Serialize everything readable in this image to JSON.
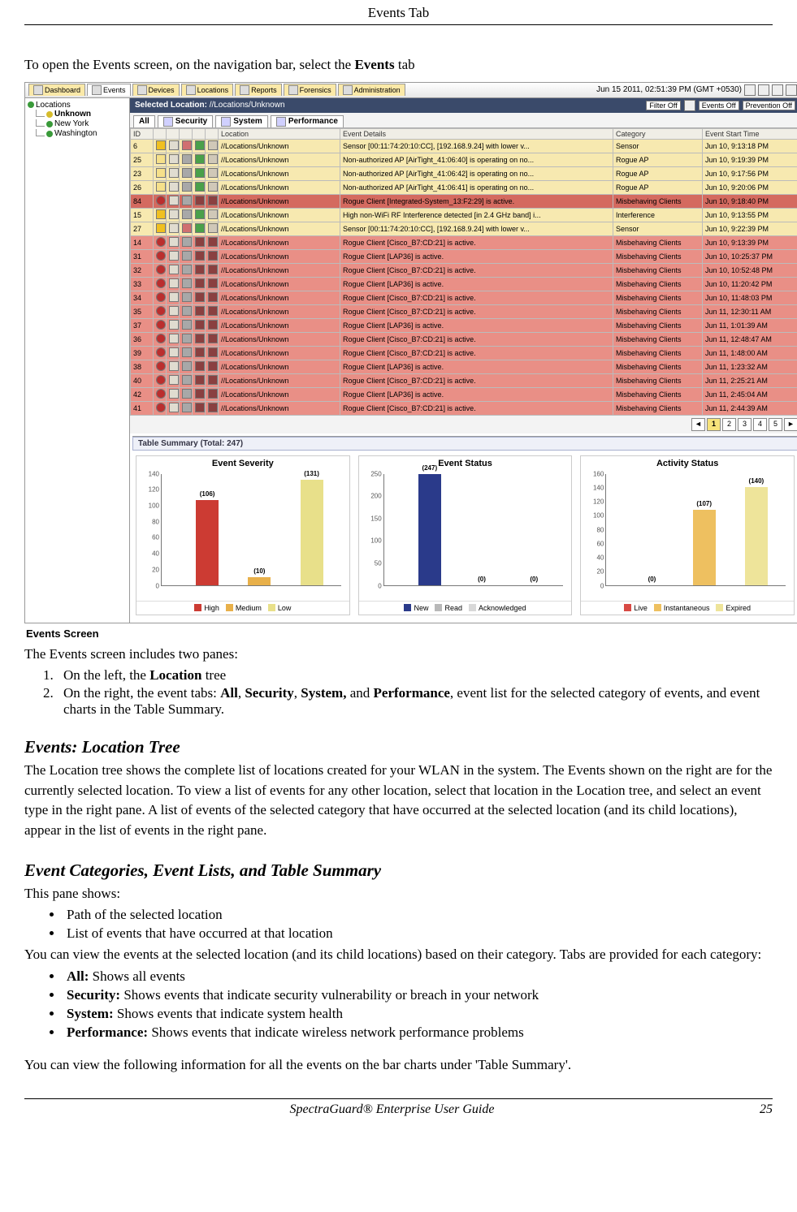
{
  "page": {
    "header_title": "Events Tab",
    "footer_left": "SpectraGuard® Enterprise User Guide",
    "footer_page": "25"
  },
  "intro": {
    "pre": "To open the Events screen, on the navigation bar, select the ",
    "bold": "Events",
    "post": " tab"
  },
  "fig": {
    "caption": "Events Screen",
    "nav_tabs": [
      "Dashboard",
      "Events",
      "Devices",
      "Locations",
      "Reports",
      "Forensics",
      "Administration"
    ],
    "clock": "Jun 15 2011, 02:51:39 PM (GMT +0530)",
    "selected_location_label": "Selected Location:",
    "selected_location_path": "//Locations/Unknown",
    "filter_label": "Filter Off",
    "events_off": "Events Off",
    "prevention_off": "Prevention Off",
    "loc_tree": [
      "Locations",
      "Unknown",
      "New York",
      "Washington"
    ],
    "subtabs": [
      "All",
      "Security",
      "System",
      "Performance"
    ],
    "columns": [
      "ID",
      "",
      "",
      "",
      "",
      "",
      "Location",
      "Event Details",
      "Category",
      "Event Start Time"
    ],
    "rows": [
      {
        "cls": "r-yellow",
        "id": "6",
        "i": [
          "warn",
          "mail",
          "del",
          "ok",
          "lock"
        ],
        "loc": "//Locations/Unknown",
        "det": "Sensor [00:11:74:20:10:CC], [192.168.9.24] with lower v...",
        "cat": "Sensor",
        "t": "Jun 10, 9:13:18 PM"
      },
      {
        "cls": "r-yellow",
        "id": "25",
        "i": [
          "sq",
          "mail",
          "grey",
          "ok",
          "lock"
        ],
        "loc": "//Locations/Unknown",
        "det": "Non-authorized AP [AirTight_41:06:40] is operating on no...",
        "cat": "Rogue AP",
        "t": "Jun 10, 9:19:39 PM"
      },
      {
        "cls": "r-yellow",
        "id": "23",
        "i": [
          "sq",
          "mail",
          "grey",
          "ok",
          "lock"
        ],
        "loc": "//Locations/Unknown",
        "det": "Non-authorized AP [AirTight_41:06:42] is operating on no...",
        "cat": "Rogue AP",
        "t": "Jun 10, 9:17:56 PM"
      },
      {
        "cls": "r-yellow",
        "id": "26",
        "i": [
          "sq",
          "mail",
          "grey",
          "ok",
          "lock"
        ],
        "loc": "//Locations/Unknown",
        "det": "Non-authorized AP [AirTight_41:06:41] is operating on no...",
        "cat": "Rogue AP",
        "t": "Jun 10, 9:20:06 PM"
      },
      {
        "cls": "r-dred",
        "id": "84",
        "i": [
          "red",
          "mail",
          "grey",
          "dk",
          "dk"
        ],
        "loc": "//Locations/Unknown",
        "det": "Rogue Client [Integrated-System_13:F2:29] is active.",
        "cat": "Misbehaving Clients",
        "t": "Jun 10, 9:18:40 PM"
      },
      {
        "cls": "r-yellow",
        "id": "15",
        "i": [
          "warn",
          "mail",
          "grey",
          "ok",
          "lock"
        ],
        "loc": "//Locations/Unknown",
        "det": "High non-WiFi RF Interference detected [in 2.4 GHz band] i...",
        "cat": "Interference",
        "t": "Jun 10, 9:13:55 PM"
      },
      {
        "cls": "r-yellow",
        "id": "27",
        "i": [
          "warn",
          "mail",
          "del",
          "ok",
          "lock"
        ],
        "loc": "//Locations/Unknown",
        "det": "Sensor [00:11:74:20:10:CC], [192.168.9.24] with lower v...",
        "cat": "Sensor",
        "t": "Jun 10, 9:22:39 PM"
      },
      {
        "cls": "r-red",
        "id": "14",
        "i": [
          "red",
          "mail",
          "grey",
          "dk",
          "dk"
        ],
        "loc": "//Locations/Unknown",
        "det": "Rogue Client [Cisco_B7:CD:21] is active.",
        "cat": "Misbehaving Clients",
        "t": "Jun 10, 9:13:39 PM"
      },
      {
        "cls": "r-red",
        "id": "31",
        "i": [
          "red",
          "mail",
          "grey",
          "dk",
          "dk"
        ],
        "loc": "//Locations/Unknown",
        "det": "Rogue Client [LAP36] is active.",
        "cat": "Misbehaving Clients",
        "t": "Jun 10, 10:25:37 PM"
      },
      {
        "cls": "r-red",
        "id": "32",
        "i": [
          "red",
          "mail",
          "grey",
          "dk",
          "dk"
        ],
        "loc": "//Locations/Unknown",
        "det": "Rogue Client [Cisco_B7:CD:21] is active.",
        "cat": "Misbehaving Clients",
        "t": "Jun 10, 10:52:48 PM"
      },
      {
        "cls": "r-red",
        "id": "33",
        "i": [
          "red",
          "mail",
          "grey",
          "dk",
          "dk"
        ],
        "loc": "//Locations/Unknown",
        "det": "Rogue Client [LAP36] is active.",
        "cat": "Misbehaving Clients",
        "t": "Jun 10, 11:20:42 PM"
      },
      {
        "cls": "r-red",
        "id": "34",
        "i": [
          "red",
          "mail",
          "grey",
          "dk",
          "dk"
        ],
        "loc": "//Locations/Unknown",
        "det": "Rogue Client [Cisco_B7:CD:21] is active.",
        "cat": "Misbehaving Clients",
        "t": "Jun 10, 11:48:03 PM"
      },
      {
        "cls": "r-red",
        "id": "35",
        "i": [
          "red",
          "mail",
          "grey",
          "dk",
          "dk"
        ],
        "loc": "//Locations/Unknown",
        "det": "Rogue Client [Cisco_B7:CD:21] is active.",
        "cat": "Misbehaving Clients",
        "t": "Jun 11, 12:30:11 AM"
      },
      {
        "cls": "r-red",
        "id": "37",
        "i": [
          "red",
          "mail",
          "grey",
          "dk",
          "dk"
        ],
        "loc": "//Locations/Unknown",
        "det": "Rogue Client [LAP36] is active.",
        "cat": "Misbehaving Clients",
        "t": "Jun 11, 1:01:39 AM"
      },
      {
        "cls": "r-red",
        "id": "36",
        "i": [
          "red",
          "mail",
          "grey",
          "dk",
          "dk"
        ],
        "loc": "//Locations/Unknown",
        "det": "Rogue Client [Cisco_B7:CD:21] is active.",
        "cat": "Misbehaving Clients",
        "t": "Jun 11, 12:48:47 AM"
      },
      {
        "cls": "r-red",
        "id": "39",
        "i": [
          "red",
          "mail",
          "grey",
          "dk",
          "dk"
        ],
        "loc": "//Locations/Unknown",
        "det": "Rogue Client [Cisco_B7:CD:21] is active.",
        "cat": "Misbehaving Clients",
        "t": "Jun 11, 1:48:00 AM"
      },
      {
        "cls": "r-red",
        "id": "38",
        "i": [
          "red",
          "mail",
          "grey",
          "dk",
          "dk"
        ],
        "loc": "//Locations/Unknown",
        "det": "Rogue Client [LAP36] is active.",
        "cat": "Misbehaving Clients",
        "t": "Jun 11, 1:23:32 AM"
      },
      {
        "cls": "r-red",
        "id": "40",
        "i": [
          "red",
          "mail",
          "grey",
          "dk",
          "dk"
        ],
        "loc": "//Locations/Unknown",
        "det": "Rogue Client [Cisco_B7:CD:21] is active.",
        "cat": "Misbehaving Clients",
        "t": "Jun 11, 2:25:21 AM"
      },
      {
        "cls": "r-red",
        "id": "42",
        "i": [
          "red",
          "mail",
          "grey",
          "dk",
          "dk"
        ],
        "loc": "//Locations/Unknown",
        "det": "Rogue Client [LAP36] is active.",
        "cat": "Misbehaving Clients",
        "t": "Jun 11, 2:45:04 AM"
      },
      {
        "cls": "r-red",
        "id": "41",
        "i": [
          "red",
          "mail",
          "grey",
          "dk",
          "dk"
        ],
        "loc": "//Locations/Unknown",
        "det": "Rogue Client [Cisco_B7:CD:21] is active.",
        "cat": "Misbehaving Clients",
        "t": "Jun 11, 2:44:39 AM"
      }
    ],
    "pager": [
      "◄",
      "1",
      "2",
      "3",
      "4",
      "5",
      "►"
    ],
    "summary_title": "Table Summary (Total: 247)"
  },
  "chart_data": [
    {
      "type": "bar",
      "title": "Event Severity",
      "categories": [
        "High",
        "Medium",
        "Low"
      ],
      "values": [
        106,
        10,
        131
      ],
      "colors": [
        "#cc3b33",
        "#e8b04a",
        "#e8e08a"
      ],
      "ylim": [
        0,
        140
      ],
      "yticks": [
        0,
        20,
        40,
        60,
        80,
        100,
        120,
        140
      ],
      "legend": [
        "High",
        "Medium",
        "Low"
      ]
    },
    {
      "type": "bar",
      "title": "Event Status",
      "categories": [
        "New",
        "Read",
        "Acknowledged"
      ],
      "values": [
        247,
        0,
        0
      ],
      "colors": [
        "#2a3a8a",
        "#b8b8b8",
        "#d8d8d8"
      ],
      "ylim": [
        0,
        250
      ],
      "yticks": [
        0,
        50,
        100,
        150,
        200,
        250
      ],
      "legend": [
        "New",
        "Read",
        "Acknowledged"
      ]
    },
    {
      "type": "bar",
      "title": "Activity Status",
      "categories": [
        "Live",
        "Instantaneous",
        "Expired"
      ],
      "values": [
        0,
        107,
        140
      ],
      "colors": [
        "#d84a44",
        "#eec060",
        "#eee49a"
      ],
      "ylim": [
        0,
        160
      ],
      "yticks": [
        0,
        20,
        40,
        60,
        80,
        100,
        120,
        140,
        160
      ],
      "legend": [
        "Live",
        "Instantaneous",
        "Expired"
      ]
    }
  ],
  "body": {
    "p1": "The Events screen includes two panes:",
    "li1_pre": "On the left, the ",
    "li1_b": "Location",
    "li1_post": " tree",
    "li2_pre": "On the right, the event tabs: ",
    "li2_b1": "All",
    "li2_s1": ", ",
    "li2_b2": "Security",
    "li2_s2": ", ",
    "li2_b3": "System,",
    "li2_s3": " and ",
    "li2_b4": "Performance",
    "li2_post": ", event list for the selected category of events, and event charts in the Table Summary.",
    "h2a": "Events: Location Tree",
    "p2": "The Location tree shows the complete list of locations created for your WLAN in the system. The Events shown on the right are for the currently selected location. To view a list of events for any other location, select that location in the Location tree, and select an event type in the right pane. A list of events of the selected category that have occurred at the selected location (and its child locations), appear in the list of events in the right pane.",
    "h2b": "Event Categories, Event Lists, and Table Summary",
    "p3": "This pane shows:",
    "b1": "Path of the selected location",
    "b2": " List of events that have occurred at that location",
    "p4": "You can view the events at the selected location (and its child locations) based on their category. Tabs are provided for each category:",
    "c1b": "All:",
    "c1t": " Shows all events",
    "c2b": "Security:",
    "c2t": " Shows events that indicate security vulnerability or breach in your network",
    "c3b": "System:",
    "c3t": " Shows events that indicate system health",
    "c4b": "Performance:",
    "c4t": " Shows events that indicate wireless network performance problems",
    "p5": "You can view the following information for all the events on the bar charts under 'Table Summary'."
  }
}
